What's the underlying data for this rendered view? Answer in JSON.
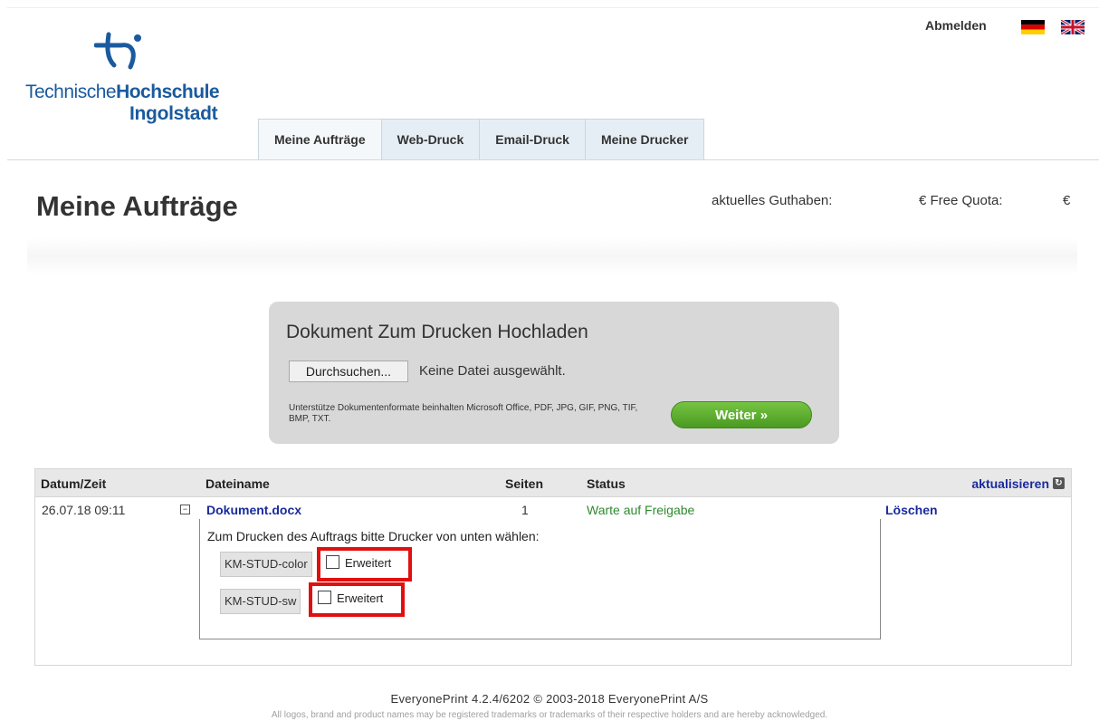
{
  "logo": {
    "line1_regular": "Technische",
    "line1_bold": "Hochschule",
    "line2": "Ingolstadt"
  },
  "header": {
    "logout": "Abmelden",
    "lang_de": "DE",
    "lang_en": "EN"
  },
  "tabs": [
    {
      "label": "Meine Aufträge"
    },
    {
      "label": "Web-Druck"
    },
    {
      "label": "Email-Druck"
    },
    {
      "label": "Meine Drucker"
    }
  ],
  "page": {
    "title": "Meine Aufträge",
    "balance_label": "aktuelles Guthaben:",
    "free_quota_label": "€ Free Quota:",
    "currency": "€"
  },
  "upload": {
    "title": "Dokument Zum Drucken Hochladen",
    "browse_label": "Durchsuchen...",
    "no_file_text": "Keine Datei ausgewählt.",
    "formats_text": "Unterstütze Dokumentenformate beinhalten Microsoft Office, PDF, JPG, GIF, PNG, TIF, BMP, TXT.",
    "next_label": "Weiter »"
  },
  "table": {
    "headers": {
      "date": "Datum/Zeit",
      "filename": "Dateiname",
      "pages": "Seiten",
      "status": "Status",
      "refresh": "aktualisieren"
    },
    "rows": [
      {
        "date": "26.07.18 09:11",
        "toggle": "−",
        "filename": "Dokument.docx",
        "pages": "1",
        "status": "Warte auf Freigabe",
        "delete": "Löschen"
      }
    ],
    "printer_hint": "Zum Drucken des Auftrags bitte Drucker von unten wählen:",
    "printers": [
      {
        "name": "KM-STUD-color",
        "advanced_label": "Erweitert"
      },
      {
        "name": "KM-STUD-sw",
        "advanced_label": "Erweitert"
      }
    ]
  },
  "footer": {
    "line1": "EveryonePrint 4.2.4/6202 © 2003-2018 EveryonePrint A/S",
    "line2": "All logos, brand and product names may be registered trademarks or trademarks of their respective holders and are hereby acknowledged."
  },
  "colors": {
    "brand_blue": "#1a5a9e",
    "link_blue": "#1a2a9e",
    "status_green": "#2f8a2f",
    "button_green": "#5cae30",
    "highlight_red": "#e01010"
  }
}
